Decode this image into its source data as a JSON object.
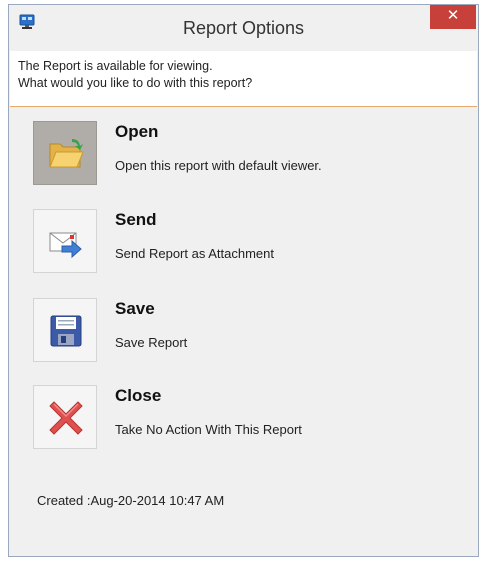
{
  "window": {
    "title": "Report Options",
    "close_glyph": "✕",
    "app_icon": "monitor-icon"
  },
  "message": {
    "line1": "The Report is available for viewing.",
    "line2": "What would you like to do with this report?"
  },
  "actions": [
    {
      "label": "Open",
      "description": "Open this report with default viewer.",
      "icon": "folder-open-icon",
      "selected": true
    },
    {
      "label": "Send",
      "description": "Send Report as Attachment",
      "icon": "envelope-send-icon",
      "selected": false
    },
    {
      "label": "Save",
      "description": "Save Report",
      "icon": "floppy-disk-icon",
      "selected": false
    },
    {
      "label": "Close",
      "description": "Take No Action With This Report",
      "icon": "red-x-icon",
      "selected": false
    }
  ],
  "footer": {
    "created": "Created :Aug-20-2014 10:47 AM"
  },
  "colors": {
    "close_button": "#c7413a",
    "separator": "#e8a868",
    "selected_tile": "#b0aca8"
  }
}
